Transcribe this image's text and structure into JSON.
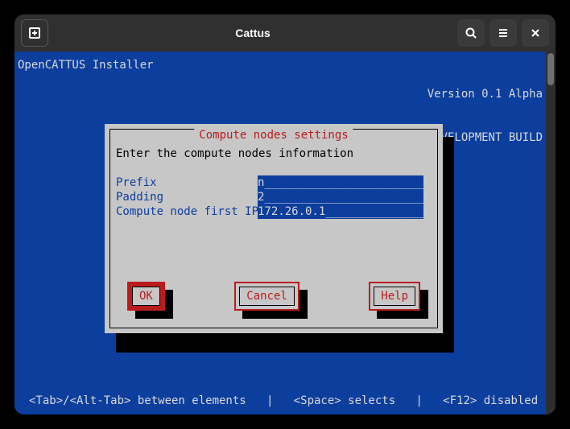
{
  "titlebar": {
    "title": "Cattus"
  },
  "header": {
    "left": "OpenCATTUS Installer",
    "right_line1": "Version 0.1 Alpha",
    "right_line2": "DEVELOPMENT BUILD"
  },
  "dialog": {
    "title": " Compute nodes settings ",
    "instruction": "Enter the compute nodes information",
    "fields": [
      {
        "label": "Prefix",
        "value": "n"
      },
      {
        "label": "Padding",
        "value": "2"
      },
      {
        "label": "Compute node first IP",
        "value": "172.26.0.1"
      }
    ],
    "buttons": {
      "ok": "OK",
      "cancel": "Cancel",
      "help": "Help"
    }
  },
  "footer": "<Tab>/<Alt-Tab> between elements   |   <Space> selects   |   <F12> disabled"
}
